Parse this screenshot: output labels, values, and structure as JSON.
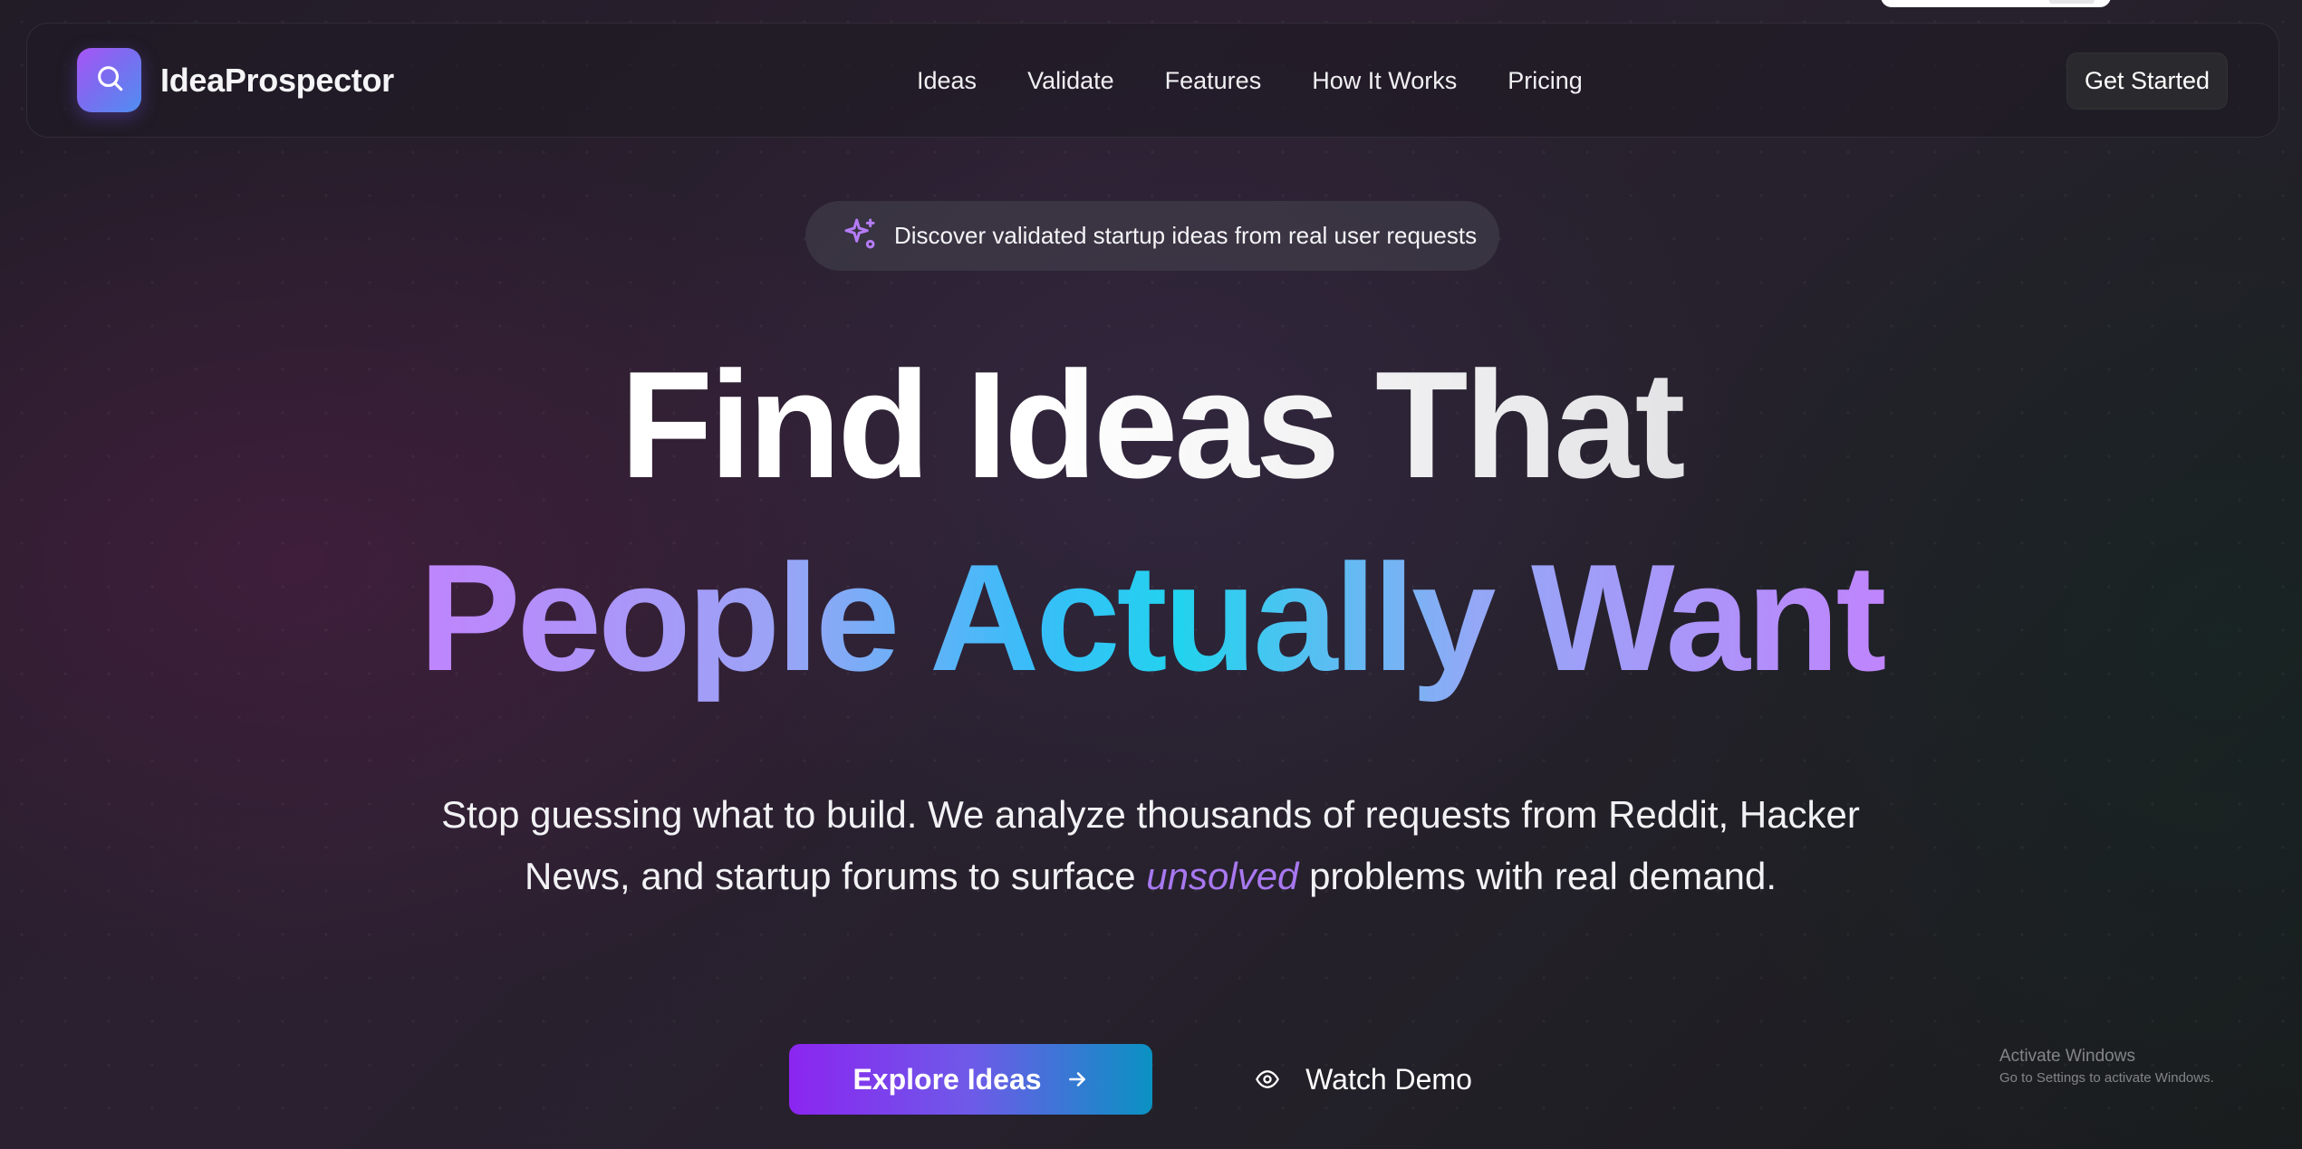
{
  "brand": {
    "name": "IdeaProspector",
    "logo_icon": "search-icon",
    "logo_gradient": [
      "#a855f7",
      "#4f8ef0"
    ]
  },
  "nav": {
    "links": [
      "Ideas",
      "Validate",
      "Features",
      "How It Works",
      "Pricing"
    ],
    "cta_label": "Get Started"
  },
  "hero": {
    "badge_icon": "sparkles-icon",
    "badge_text": "Discover validated startup ideas from real user requests",
    "headline_line1": "Find Ideas That",
    "headline_line2": "People Actually Want",
    "lead_before": "Stop guessing what to build. We analyze thousands of requests from Reddit, Hacker News, and startup forums to surface ",
    "lead_highlight": "unsolved",
    "lead_after": " problems with real demand.",
    "primary_button": "Explore Ideas",
    "primary_button_icon": "arrow-right-icon",
    "secondary_button": "Watch Demo",
    "secondary_button_icon": "eye-icon"
  },
  "colors": {
    "accent_purple": "#a855f7",
    "accent_cyan": "#22d3ee",
    "highlight_text": "#a878f0"
  },
  "os_watermark": {
    "title": "Activate Windows",
    "subtitle": "Go to Settings to activate Windows."
  }
}
